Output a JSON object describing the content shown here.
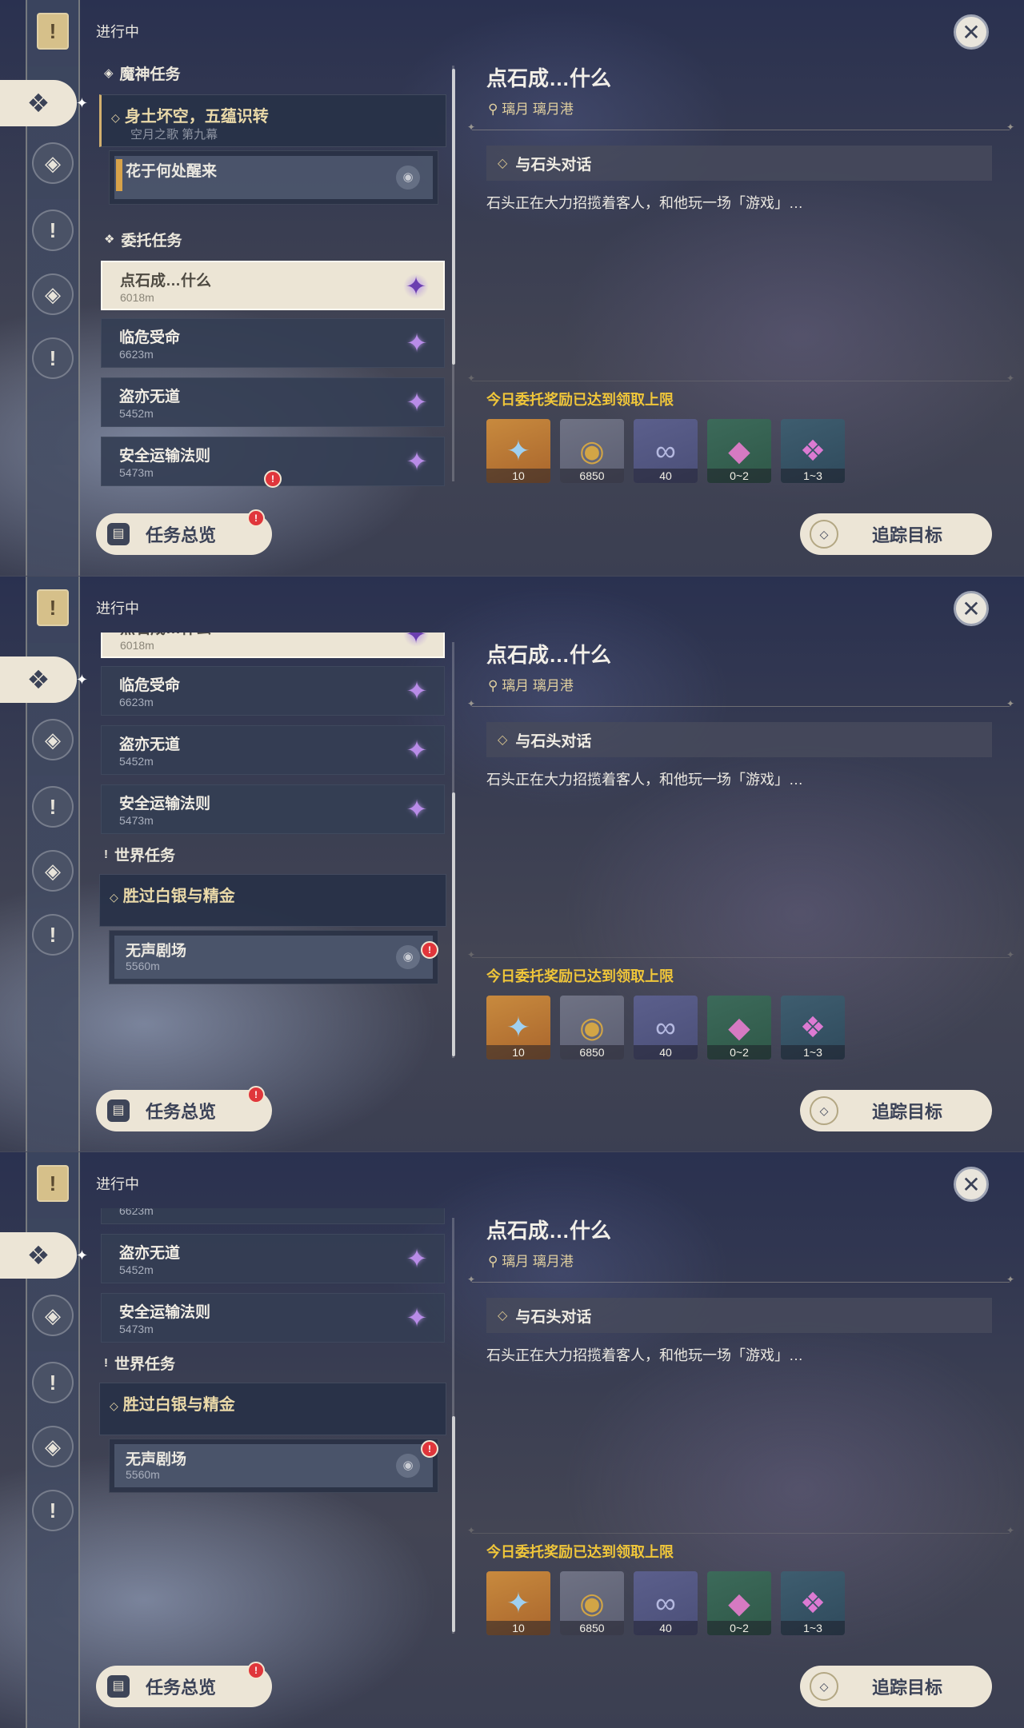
{
  "status_label": "进行中",
  "close_symbol": "✕",
  "sections": {
    "archon": "魔神任务",
    "commission": "委托任务",
    "world": "世界任务"
  },
  "archon_quest": {
    "title": "身土坏空，五蕴识转",
    "chapter": "空月之歌 第九幕",
    "step": "花于何处醒来"
  },
  "commissions": [
    {
      "title": "点石成…什么",
      "distance": "6018m"
    },
    {
      "title": "临危受命",
      "distance": "6623m"
    },
    {
      "title": "盗亦无道",
      "distance": "5452m"
    },
    {
      "title": "安全运输法则",
      "distance": "5473m"
    }
  ],
  "world_quest": {
    "title": "胜过白银与精金",
    "step": "无声剧场",
    "distance": "5560m"
  },
  "overview_label": "任务总览",
  "detail": {
    "title": "点石成…什么",
    "location": "璃月  璃月港",
    "objective": "与石头对话",
    "description": "石头正在大力招揽着客人，和他玩一场「游戏」…",
    "reward_note": "今日委托奖励已达到领取上限",
    "rewards": [
      {
        "icon": "primogem-icon",
        "qty": "10"
      },
      {
        "icon": "mora-icon",
        "qty": "6850"
      },
      {
        "icon": "adventure-exp-icon",
        "qty": "40"
      },
      {
        "icon": "crystal-icon",
        "qty": "0~2"
      },
      {
        "icon": "crystal-cluster-icon",
        "qty": "1~3"
      }
    ]
  },
  "track_label": "追踪目标",
  "colors": {
    "accent_gold": "#f0c63a",
    "button_bg": "#ece5d6",
    "badge_red": "#e0363b"
  }
}
